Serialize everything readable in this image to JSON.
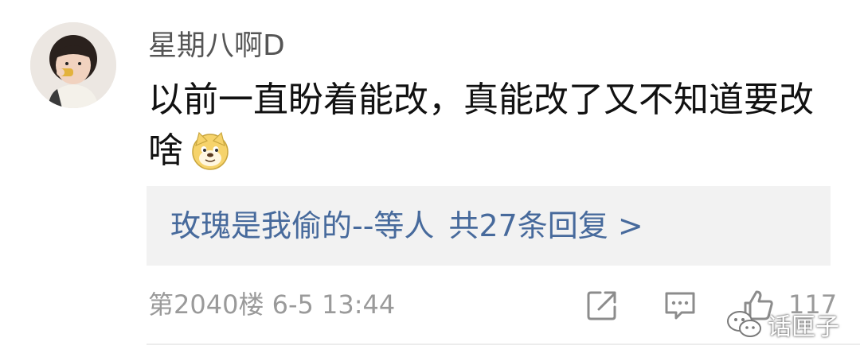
{
  "comment": {
    "username": "星期八啊D",
    "text_line1": "以前一直盼着能改，真能改了又不知道要改",
    "text_line2": "啥",
    "reply": {
      "user_prefix": "玫瑰是我偷的--等人",
      "count_label": "共27条回复 >"
    },
    "floor_time": "第2040楼 6-5 13:44",
    "likes": "117",
    "icons": [
      "share-icon",
      "reply-icon",
      "like-icon",
      "doge-emoji"
    ]
  },
  "watermark": {
    "label": "话匣子",
    "icon": "wechat-icon"
  },
  "colors": {
    "username": "#555555",
    "text": "#111111",
    "reply_link": "#476a9c",
    "meta": "#9a9a9a",
    "reply_bg": "#f2f2f2"
  }
}
